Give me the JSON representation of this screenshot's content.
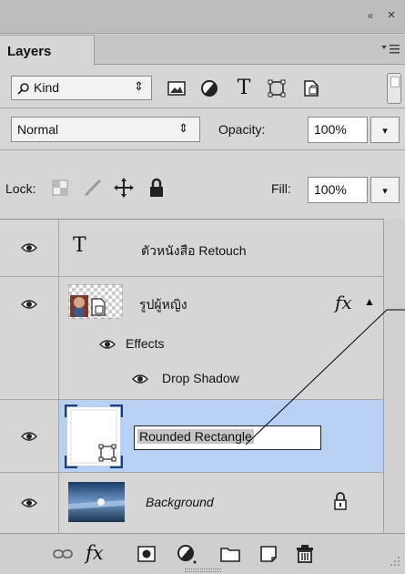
{
  "header": {
    "collapse_glyph": "«",
    "close_glyph": "×"
  },
  "tab": {
    "label": "Layers",
    "menu_icon": "panel-menu-icon"
  },
  "filter": {
    "kind_label": "Kind",
    "kind_arrow": "⇕",
    "icons": [
      "image-filter-icon",
      "adjustment-filter-icon",
      "type-filter-icon",
      "shape-filter-icon",
      "smart-object-filter-icon"
    ],
    "type_glyph": "T"
  },
  "blend": {
    "mode": "Normal",
    "arrow": "⇕",
    "opacity_label": "Opacity:",
    "opacity_value": "100%",
    "drop": "▾"
  },
  "lock": {
    "label": "Lock:",
    "fill_label": "Fill:",
    "fill_value": "100%",
    "drop": "▾"
  },
  "layers": [
    {
      "name": "ตัวหนังสือ Retouch",
      "type_glyph": "T",
      "visible": true
    },
    {
      "name": "รูปผู้หญิง",
      "fx_label": "fx",
      "collapse": "▲",
      "visible": true,
      "effects_label": "Effects",
      "effect_items": [
        "Drop Shadow"
      ]
    },
    {
      "name": "Rounded Rectangle",
      "visible": true,
      "selected": true
    },
    {
      "name": "Background",
      "visible": true,
      "locked": true
    }
  ],
  "bottom": {
    "fx_label": "fx"
  },
  "colors": {
    "selection": "#b8d0f4",
    "panel": "#d6d6d6"
  }
}
